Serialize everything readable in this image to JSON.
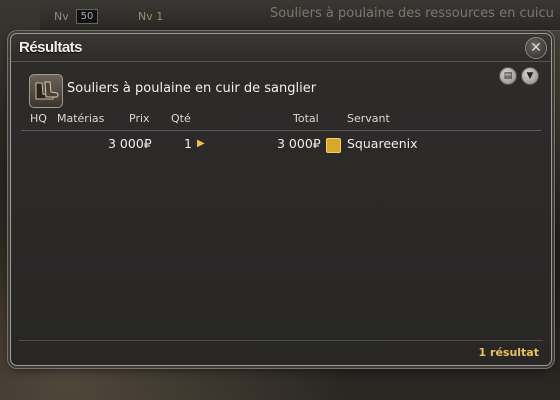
{
  "background": {
    "level_label": "Nv",
    "level_value": "50",
    "level2_label": "Nv 1",
    "window_title": "Souliers à poulaine des ressources en cuicu"
  },
  "window": {
    "title": "Résultats",
    "close_icon": "crossed-swords-icon"
  },
  "item": {
    "name": "Souliers à poulaine en cuir de sanglier",
    "icon": "boots-icon"
  },
  "toolbar": {
    "history_icon": "document-icon",
    "filter_icon": "filter-icon"
  },
  "table": {
    "headers": {
      "hq": "HQ",
      "materia": "Matérias",
      "price": "Prix",
      "qty": "Qté",
      "total": "Total",
      "retainer": "Servant"
    },
    "rows": [
      {
        "price": "3 000₽",
        "qty": "1",
        "total": "3 000₽",
        "retainer": "Squareenix"
      }
    ]
  },
  "footer": {
    "count": "1 résultat"
  },
  "colors": {
    "accent": "#e8c25a",
    "window_bg": "#2b2a29",
    "frame": "#9e9a92"
  }
}
